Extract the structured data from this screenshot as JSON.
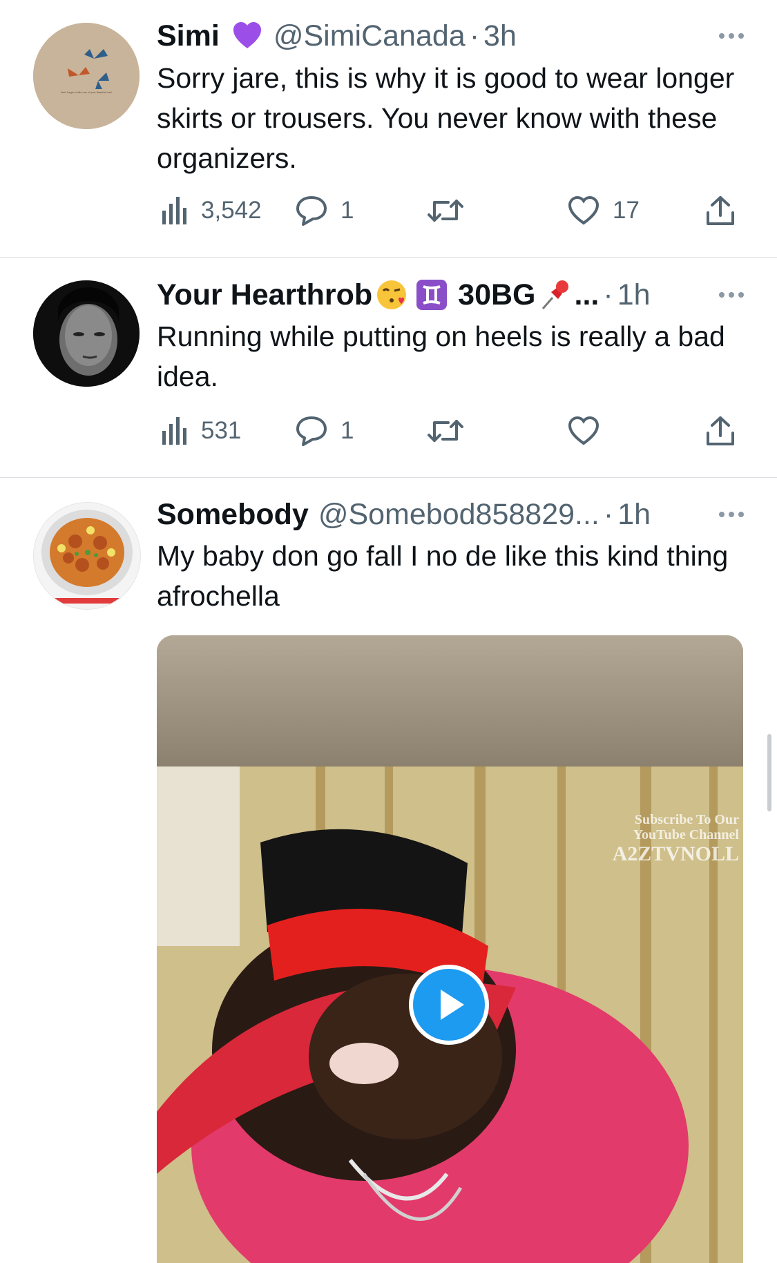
{
  "tweets": [
    {
      "name": "Simi",
      "name_emoji": "purple-heart",
      "handle": "@SimiCanada",
      "separator": "·",
      "time": "3h",
      "text": "Sorry jare, this is why it is good to wear longer skirts or trousers. You never know with these organizers.",
      "views": "3,542",
      "replies": "1",
      "retweets": "",
      "likes": "17",
      "avatar": "butterfly-avatar",
      "avatar_caption": "don't forget to take care of your beautiful soul"
    },
    {
      "name": "Your Hearthrob",
      "name_suffix": "30BG",
      "name_emoji": [
        "kissing-face",
        "gemini-sign",
        "pushpin"
      ],
      "truncation": "...",
      "separator": "·",
      "time": "1h",
      "text": "Running while putting on heels is really a bad idea.",
      "views": "531",
      "replies": "1",
      "retweets": "",
      "likes": "",
      "avatar": "portrait-avatar"
    },
    {
      "name": "Somebody",
      "handle": "@Somebod858829...",
      "separator": "·",
      "time": "1h",
      "text": "My baby don go fall I no de like this kind thing afrochella",
      "avatar": "food-plate-avatar",
      "media": {
        "type": "video",
        "watermark": [
          "Subscribe To Our",
          "YouTube Channel",
          "A2ZTVNOLL"
        ],
        "play_icon": "play-icon"
      }
    }
  ],
  "colors": {
    "text": "#0f1419",
    "secondary": "#536471",
    "accent": "#1d9bf0",
    "divider": "#dcdfe3"
  }
}
